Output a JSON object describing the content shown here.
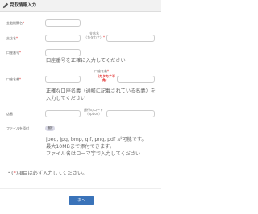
{
  "header": {
    "title": "受取情報入力"
  },
  "fields": {
    "financial_institution": {
      "label": "金融機関名",
      "required_mark": "*"
    },
    "branch": {
      "label": "支店名",
      "required_mark": "*",
      "kana_label": "支店名\n（カタカナ）",
      "kana_required_mark": "*"
    },
    "account_number": {
      "label": "口座番号",
      "required_mark": "*",
      "hint": "口座番号を正確に入力してください"
    },
    "account_name": {
      "label": "口座名義",
      "required_mark": "*",
      "kana_label": "口座名義",
      "kana_required_mark": "*",
      "kana_red_note": "（カタカナ半角）",
      "hint_line1": "正確な口座名義（通帳に記載されている名義）を",
      "hint_line2": "入力してください"
    },
    "bank_code": {
      "label": "店番",
      "code_label": "銀行のコード\n（option）"
    },
    "file_attach": {
      "label": "ファイルを添付",
      "button_label": "選択"
    }
  },
  "file_hint": {
    "line1": "jpeg, jpg, bmp, gif, png, pdf が可能です。",
    "line2": "最大10MBまで添付できます。",
    "line3": "ファイル名はローマ字で入力してください"
  },
  "required_note": {
    "prefix": "・(",
    "mark": "*",
    "suffix": ")項目は必ず入力してください。"
  },
  "next_button": {
    "label": "次へ"
  }
}
